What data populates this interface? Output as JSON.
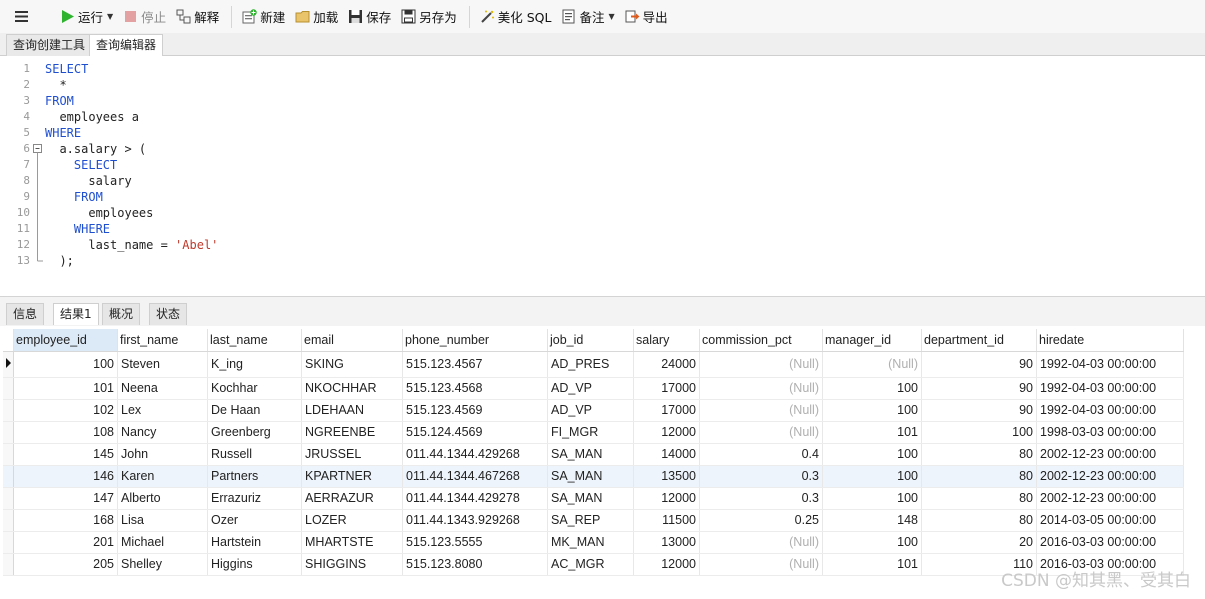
{
  "toolbar": {
    "menu_icon": "hamburger-icon",
    "run": "运行",
    "stop": "停止",
    "explain": "解释",
    "new": "新建",
    "load": "加载",
    "save": "保存",
    "save_as": "另存为",
    "beautify": "美化 SQL",
    "comment": "备注",
    "export": "导出"
  },
  "editor_tabs": [
    "查询创建工具",
    "查询编辑器"
  ],
  "sql": {
    "lines": [
      {
        "num": "1",
        "code": "SELECT"
      },
      {
        "num": "2",
        "code": "  *"
      },
      {
        "num": "3",
        "code": "FROM"
      },
      {
        "num": "4",
        "code": "  employees a"
      },
      {
        "num": "5",
        "code": "WHERE"
      },
      {
        "num": "6",
        "code": "  a.salary > ("
      },
      {
        "num": "7",
        "code": "    SELECT"
      },
      {
        "num": "8",
        "code": "      salary"
      },
      {
        "num": "9",
        "code": "    FROM"
      },
      {
        "num": "10",
        "code": "      employees"
      },
      {
        "num": "11",
        "code": "    WHERE"
      },
      {
        "num": "12",
        "code": "      last_name = 'Abel'"
      },
      {
        "num": "13",
        "code": "  );"
      }
    ]
  },
  "result_tabs": [
    "信息",
    "结果1",
    "概况",
    "状态"
  ],
  "grid": {
    "columns": [
      "employee_id",
      "first_name",
      "last_name",
      "email",
      "phone_number",
      "job_id",
      "salary",
      "commission_pct",
      "manager_id",
      "department_id",
      "hiredate"
    ],
    "rows": [
      [
        "100",
        "Steven",
        "K_ing",
        "SKING",
        "515.123.4567",
        "AD_PRES",
        "24000",
        "(Null)",
        "(Null)",
        "90",
        "1992-04-03 00:00:00"
      ],
      [
        "101",
        "Neena",
        "Kochhar",
        "NKOCHHAR",
        "515.123.4568",
        "AD_VP",
        "17000",
        "(Null)",
        "100",
        "90",
        "1992-04-03 00:00:00"
      ],
      [
        "102",
        "Lex",
        "De Haan",
        "LDEHAAN",
        "515.123.4569",
        "AD_VP",
        "17000",
        "(Null)",
        "100",
        "90",
        "1992-04-03 00:00:00"
      ],
      [
        "108",
        "Nancy",
        "Greenberg",
        "NGREENBE",
        "515.124.4569",
        "FI_MGR",
        "12000",
        "(Null)",
        "101",
        "100",
        "1998-03-03 00:00:00"
      ],
      [
        "145",
        "John",
        "Russell",
        "JRUSSEL",
        "011.44.1344.429268",
        "SA_MAN",
        "14000",
        "0.4",
        "100",
        "80",
        "2002-12-23 00:00:00"
      ],
      [
        "146",
        "Karen",
        "Partners",
        "KPARTNER",
        "011.44.1344.467268",
        "SA_MAN",
        "13500",
        "0.3",
        "100",
        "80",
        "2002-12-23 00:00:00"
      ],
      [
        "147",
        "Alberto",
        "Errazuriz",
        "AERRAZUR",
        "011.44.1344.429278",
        "SA_MAN",
        "12000",
        "0.3",
        "100",
        "80",
        "2002-12-23 00:00:00"
      ],
      [
        "168",
        "Lisa",
        "Ozer",
        "LOZER",
        "011.44.1343.929268",
        "SA_REP",
        "11500",
        "0.25",
        "148",
        "80",
        "2014-03-05 00:00:00"
      ],
      [
        "201",
        "Michael",
        "Hartstein",
        "MHARTSTE",
        "515.123.5555",
        "MK_MAN",
        "13000",
        "(Null)",
        "100",
        "20",
        "2016-03-03 00:00:00"
      ],
      [
        "205",
        "Shelley",
        "Higgins",
        "SHIGGINS",
        "515.123.8080",
        "AC_MGR",
        "12000",
        "(Null)",
        "101",
        "110",
        "2016-03-03 00:00:00"
      ]
    ]
  },
  "watermark": "CSDN @知其黑、受其白"
}
